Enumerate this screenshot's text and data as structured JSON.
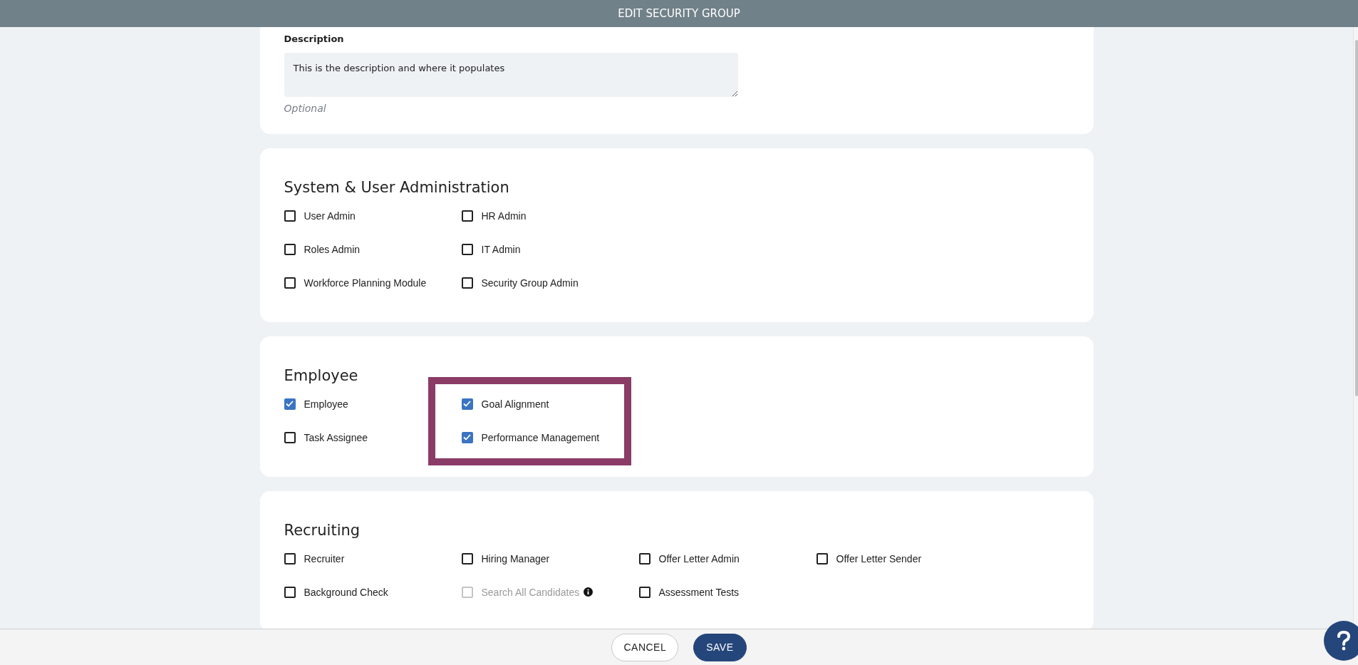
{
  "header": {
    "title": "EDIT SECURITY GROUP"
  },
  "description": {
    "label": "Description",
    "value": "This is the description and where it populates",
    "hint": "Optional"
  },
  "sections": [
    {
      "title": "System & User Administration",
      "columns": [
        {
          "highlighted": false,
          "items": [
            {
              "label": "User Admin",
              "checked": false,
              "disabled": false
            },
            {
              "label": "Roles Admin",
              "checked": false,
              "disabled": false
            },
            {
              "label": "Workforce Planning Module",
              "checked": false,
              "disabled": false
            }
          ]
        },
        {
          "highlighted": false,
          "items": [
            {
              "label": "HR Admin",
              "checked": false,
              "disabled": false
            },
            {
              "label": "IT Admin",
              "checked": false,
              "disabled": false
            },
            {
              "label": "Security Group Admin",
              "checked": false,
              "disabled": false
            }
          ]
        }
      ]
    },
    {
      "title": "Employee",
      "columns": [
        {
          "highlighted": false,
          "items": [
            {
              "label": "Employee",
              "checked": true,
              "disabled": false
            },
            {
              "label": "Task Assignee",
              "checked": false,
              "disabled": false
            }
          ]
        },
        {
          "highlighted": true,
          "items": [
            {
              "label": "Goal Alignment",
              "checked": true,
              "disabled": false
            },
            {
              "label": "Performance Management",
              "checked": true,
              "disabled": false
            }
          ]
        }
      ]
    },
    {
      "title": "Recruiting",
      "columns": [
        {
          "highlighted": false,
          "items": [
            {
              "label": "Recruiter",
              "checked": false,
              "disabled": false
            },
            {
              "label": "Background Check",
              "checked": false,
              "disabled": false
            }
          ]
        },
        {
          "highlighted": false,
          "items": [
            {
              "label": "Hiring Manager",
              "checked": false,
              "disabled": false
            },
            {
              "label": "Search All Candidates",
              "checked": false,
              "disabled": true,
              "info": true
            }
          ]
        },
        {
          "highlighted": false,
          "items": [
            {
              "label": "Offer Letter Admin",
              "checked": false,
              "disabled": false
            },
            {
              "label": "Assessment Tests",
              "checked": false,
              "disabled": false
            }
          ]
        },
        {
          "highlighted": false,
          "items": [
            {
              "label": "Offer Letter Sender",
              "checked": false,
              "disabled": false
            }
          ]
        }
      ]
    }
  ],
  "footer": {
    "buttons": [
      {
        "label": "CANCEL",
        "kind": "secondary"
      },
      {
        "label": "SAVE",
        "kind": "primary"
      }
    ]
  }
}
